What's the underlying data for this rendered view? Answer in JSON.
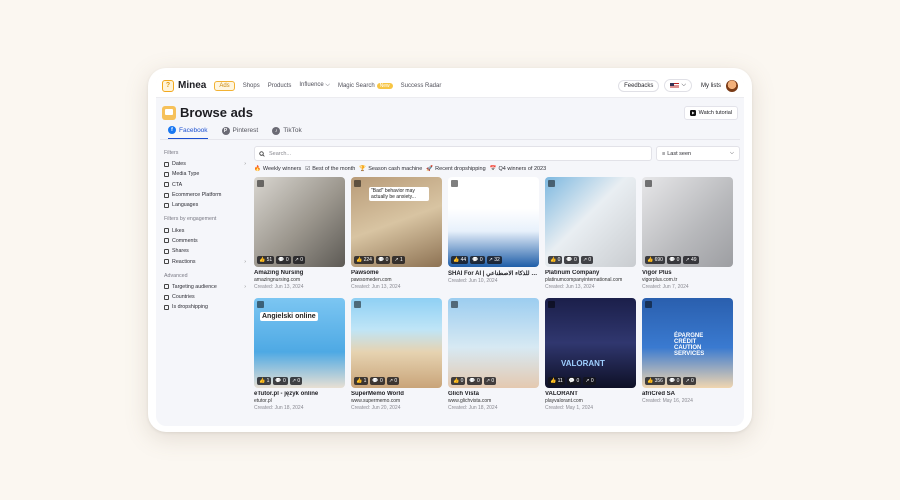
{
  "topbar": {
    "logo": "Minea",
    "nav": [
      {
        "label": "Ads",
        "active": true
      },
      {
        "label": "Shops"
      },
      {
        "label": "Products"
      },
      {
        "label": "Influence ⌵"
      },
      {
        "label": "Magic Search",
        "badge": "New"
      },
      {
        "label": "Success Radar"
      }
    ],
    "feedbacks": "Feedbacks",
    "language_caret": "⌵",
    "my_lists": "My lists"
  },
  "page": {
    "title": "Browse ads",
    "tutorial": "Watch tutorial"
  },
  "tabs": [
    {
      "label": "Facebook",
      "active": true,
      "color": "#1877f2",
      "glyph": "f"
    },
    {
      "label": "Pinterest",
      "color": "#6b6b75",
      "glyph": "P"
    },
    {
      "label": "TikTok",
      "color": "#6b6b75",
      "glyph": "♪"
    }
  ],
  "sidebar": {
    "filters_title": "Filters",
    "filters": [
      {
        "label": "Dates",
        "chevron": "›"
      },
      {
        "label": "Media Type"
      },
      {
        "label": "CTA"
      },
      {
        "label": "Ecommerce Platform"
      },
      {
        "label": "Languages"
      }
    ],
    "engagement_title": "Filters by engagement",
    "engagement": [
      {
        "label": "Likes"
      },
      {
        "label": "Comments"
      },
      {
        "label": "Shares"
      },
      {
        "label": "Reactions",
        "chevron": "›"
      }
    ],
    "advanced_title": "Advanced",
    "advanced": [
      {
        "label": "Targeting audience",
        "chevron": "›"
      },
      {
        "label": "Countries"
      },
      {
        "label": "Is dropshipping"
      }
    ]
  },
  "search": {
    "placeholder": "Search..."
  },
  "sort": {
    "value": "Last seen",
    "caret": "⌵"
  },
  "chips": [
    {
      "icon": "🔥",
      "label": "Weekly winners"
    },
    {
      "icon": "☑",
      "label": "Best of the month"
    },
    {
      "icon": "🏆",
      "label": "Season cash machine"
    },
    {
      "icon": "🚀",
      "label": "Recent dropshipping"
    },
    {
      "icon": "📅",
      "label": "Q4 winners of 2023"
    }
  ],
  "ads": [
    {
      "name": "Amazing Nursing",
      "domain": "amazingnursing.com",
      "date": "Created: Jun 13, 2024",
      "likes": "51",
      "comments": "0",
      "shares": "0",
      "bg": "linear-gradient(135deg,#d9d6d0,#9a958c 55%,#5d5a55)"
    },
    {
      "name": "Pawsome",
      "domain": "pawsomeden.com",
      "date": "Created: Jun 13, 2024",
      "likes": "224",
      "comments": "0",
      "shares": "1",
      "bg": "linear-gradient(160deg,#b89b78,#d8c4a2 50%,#8d7253)",
      "overlay": "\"Bad\" behavior may actually be anxiety..."
    },
    {
      "name": "SHAI For AI | شاي للذكاء الاصطناعي",
      "domain": "",
      "date": "Created: Jun 10, 2024",
      "likes": "44",
      "comments": "0",
      "shares": "32",
      "bg": "linear-gradient(180deg,#ffffff 0%,#ffffff 35%,#e8f1fb 60%,#1f5ea8 100%)"
    },
    {
      "name": "Platinum Company",
      "domain": "platinumcompanyinternational.com",
      "date": "Created: Jun 13, 2024",
      "likes": "0",
      "comments": "0",
      "shares": "0",
      "bg": "linear-gradient(135deg,#7db8e0,#e9eef2 45%,#c9ccd0)"
    },
    {
      "name": "Vigor Plus",
      "domain": "vigorplus.com.tr",
      "date": "Created: Jun 7, 2024",
      "likes": "690",
      "comments": "0",
      "shares": "49",
      "bg": "linear-gradient(135deg,#e7e7e9,#b7b8bb 60%,#9d9ea2)"
    },
    {
      "name": "eTutor.pl - język online",
      "domain": "etutor.pl",
      "date": "Created: Jun 18, 2024",
      "likes": "1",
      "comments": "0",
      "shares": "0",
      "bg": "linear-gradient(180deg,#7cc6f2,#4ea9e4 60%,#e8e0d4)",
      "overlay": "Angielski online"
    },
    {
      "name": "SuperMemo World",
      "domain": "www.supermemo.com",
      "date": "Created: Jun 20, 2024",
      "likes": "1",
      "comments": "0",
      "shares": "0",
      "bg": "linear-gradient(180deg,#8fd0f4 0%,#bfe5f7 35%,#e6d3b1 60%,#c9a479 100%)"
    },
    {
      "name": "Glich Vista",
      "domain": "www.glichvista.com",
      "date": "Created: Jun 18, 2024",
      "likes": "0",
      "comments": "0",
      "shares": "0",
      "bg": "linear-gradient(180deg,#9ccdf0,#d7e9f3 55%,#e4c9b0)"
    },
    {
      "name": "VALORANT",
      "domain": "playvalorant.com",
      "date": "Created: May 1, 2024",
      "likes": "11",
      "comments": "0",
      "shares": "0",
      "bg": "linear-gradient(180deg,#1b1f4a,#30376f 50%,#0e1026)",
      "overlay": "VALORANT"
    },
    {
      "name": "afriCred SA",
      "domain": "",
      "date": "Created: May 16, 2024",
      "likes": "356",
      "comments": "0",
      "shares": "0",
      "bg": "linear-gradient(180deg,#2a5fae 0%,#3a7ad0 55%,#f0d6b0 100%)",
      "overlay": "ÉPARGNE CRÉDIT CAUTION SERVICES"
    }
  ],
  "stat_icons": {
    "likes": "👍",
    "comments": "💬",
    "shares": "↗"
  }
}
